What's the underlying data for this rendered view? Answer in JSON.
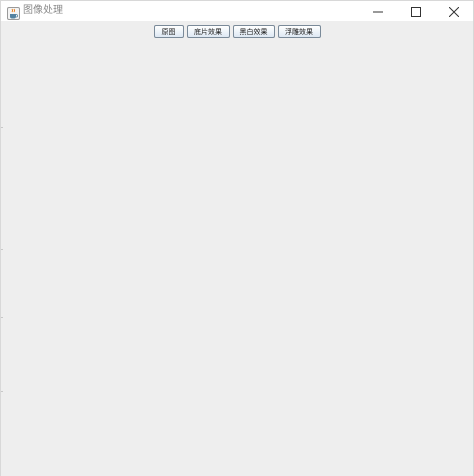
{
  "window": {
    "title": "图像处理",
    "app_icon": "java-coffee-icon",
    "controls": [
      "minimize-icon",
      "maximize-icon",
      "close-icon"
    ]
  },
  "toolbar": {
    "buttons": [
      {
        "label": "原图"
      },
      {
        "label": "底片效果"
      },
      {
        "label": "黑白效果"
      },
      {
        "label": "浮雕效果"
      }
    ]
  },
  "colors": {
    "background": "#eeeeee",
    "titlebar": "#ffffff",
    "title_text": "#8a8a8a"
  }
}
